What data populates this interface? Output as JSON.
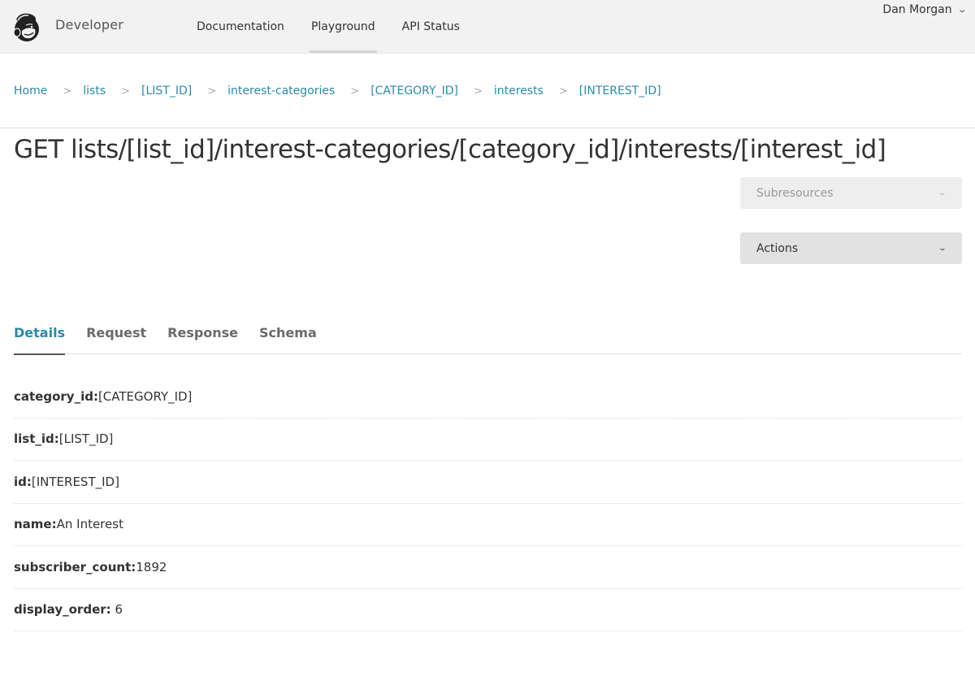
{
  "header": {
    "brand": "Developer",
    "logo_icon": "mailchimp-freddie-logo",
    "nav": [
      {
        "label": "Documentation",
        "active": false
      },
      {
        "label": "Playground",
        "active": true
      },
      {
        "label": "API Status",
        "active": false
      }
    ],
    "user": {
      "name": "Dan Morgan",
      "icon": "chevron-down-icon"
    }
  },
  "breadcrumb": [
    {
      "label": "Home"
    },
    {
      "label": "lists"
    },
    {
      "label": "[LIST_ID]"
    },
    {
      "label": "interest-categories"
    },
    {
      "label": "[CATEGORY_ID]"
    },
    {
      "label": "interests"
    },
    {
      "label": "[INTEREST_ID]"
    }
  ],
  "page": {
    "title": "GET lists/[list_id]/interest-categories/[category_id]/interests/[interest_id]"
  },
  "dropdowns": {
    "subresources": {
      "label": "Subresources",
      "disabled": true
    },
    "actions": {
      "label": "Actions"
    }
  },
  "tabs": [
    {
      "label": "Details",
      "active": true
    },
    {
      "label": "Request",
      "active": false
    },
    {
      "label": "Response",
      "active": false
    },
    {
      "label": "Schema",
      "active": false
    }
  ],
  "details": [
    {
      "key": "category_id:",
      "value": "[CATEGORY_ID]"
    },
    {
      "key": "list_id:",
      "value": "[LIST_ID]"
    },
    {
      "key": "id:",
      "value": "[INTEREST_ID]"
    },
    {
      "key": "name:",
      "value": "An Interest"
    },
    {
      "key": "subscriber_count:",
      "value": "1892"
    },
    {
      "key": "display_order:",
      "value": " 6"
    }
  ],
  "colors": {
    "accent": "#2b8aa9",
    "topbar_bg": "#f2f2f2",
    "text": "#333333"
  }
}
